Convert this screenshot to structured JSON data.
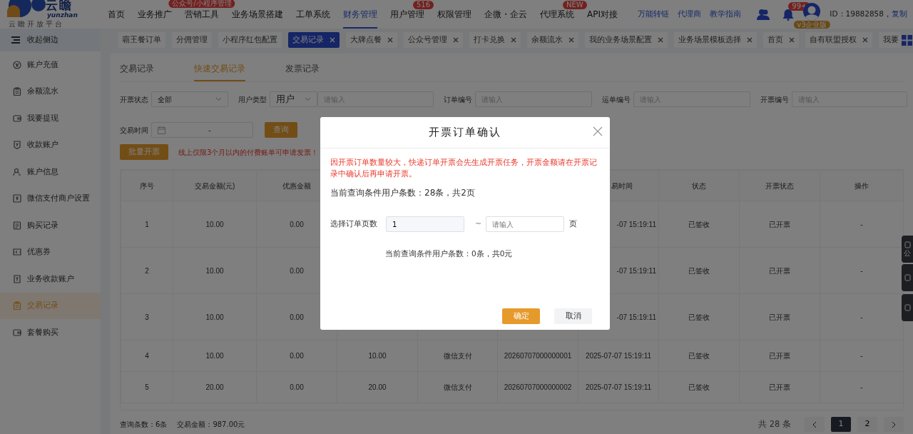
{
  "logo": {
    "title": "云瞻",
    "subtitle": "yunzhan",
    "tagline": "云瞻开放平台"
  },
  "nav": [
    {
      "label": "首页",
      "selected": false
    },
    {
      "label": "业务推广",
      "selected": false
    },
    {
      "label": "营销工具",
      "selected": false,
      "badge": "公众号/小程序管理"
    },
    {
      "label": "业务场景搭建",
      "selected": false
    },
    {
      "label": "工单系统",
      "selected": false
    },
    {
      "label": "财务管理",
      "selected": true
    },
    {
      "label": "用户管理",
      "selected": false,
      "badge": "516"
    },
    {
      "label": "权限管理",
      "selected": false
    },
    {
      "label": "企微・企云",
      "selected": false
    },
    {
      "label": "代理系统",
      "selected": false,
      "badge": "NEW"
    },
    {
      "label": "API对接",
      "selected": false
    }
  ],
  "header_links": [
    "万能转链",
    "代理商",
    "教学指南"
  ],
  "notifications": {
    "badge": "99+"
  },
  "account": {
    "edition": "v3企业版",
    "id": "ID：19882858，",
    "copy": "复制"
  },
  "sidebar": {
    "collapse": "收起侧边",
    "items": [
      {
        "label": "账户充值",
        "selected": false
      },
      {
        "label": "余额流水",
        "selected": false
      },
      {
        "label": "我要提现",
        "selected": false
      },
      {
        "label": "收款账户",
        "selected": false
      },
      {
        "label": "账户信息",
        "selected": false
      },
      {
        "label": "微信支付商户设置",
        "selected": false
      },
      {
        "label": "购买记录",
        "selected": false
      },
      {
        "label": "优惠券",
        "selected": false
      },
      {
        "label": "业务收款账户",
        "selected": false
      },
      {
        "label": "交易记录",
        "selected": true
      },
      {
        "label": "套餐购买",
        "selected": false
      }
    ]
  },
  "open_tabs": [
    {
      "label": "霸王餐订单",
      "selected": false,
      "closable": false
    },
    {
      "label": "分佣管理",
      "selected": false,
      "closable": false
    },
    {
      "label": "小程序红包配置",
      "selected": false,
      "closable": false
    },
    {
      "label": "交易记录",
      "selected": true,
      "closable": true
    },
    {
      "label": "大牌点餐",
      "selected": false,
      "closable": true
    },
    {
      "label": "公众号管理",
      "selected": false,
      "closable": true
    },
    {
      "label": "打卡兑换",
      "selected": false,
      "closable": true
    },
    {
      "label": "余额流水",
      "selected": false,
      "closable": true
    },
    {
      "label": "我的业务场景配置",
      "selected": false,
      "closable": true
    },
    {
      "label": "业务场景模板选择",
      "selected": false,
      "closable": true
    },
    {
      "label": "首页",
      "selected": false,
      "closable": true
    },
    {
      "label": "自有联盟授权",
      "selected": false,
      "closable": true
    },
    {
      "label": "我要",
      "selected": false,
      "closable": false
    }
  ],
  "page_tabs": [
    {
      "label": "交易记录",
      "selected": false
    },
    {
      "label": "快速交易记录",
      "selected": true
    },
    {
      "label": "发票记录",
      "selected": false
    }
  ],
  "filters": {
    "invoice_status": {
      "label": "开票状态",
      "value": "全部"
    },
    "user_type": {
      "label": "用户类型",
      "value": "用户",
      "placeholder": "请输入"
    },
    "order_no": {
      "label": "订单编号",
      "placeholder": "请输入"
    },
    "waybill_no": {
      "label": "运单编号",
      "placeholder": "请输入"
    },
    "invoice_no": {
      "label": "开票编号",
      "placeholder": "请输入"
    },
    "time": {
      "label": "交易时间",
      "separator": "-"
    },
    "search": "查询"
  },
  "batch_button": "批量开票",
  "notice": "线上仅限3个月以内的付费账单可申请发票！",
  "table": {
    "columns": [
      "序号",
      "交易金额(元)",
      "优惠金额",
      null,
      null,
      null,
      "易时间",
      "状态",
      "开票状态",
      "操作"
    ],
    "rows": [
      [
        "1",
        "10.00",
        "0.00",
        null,
        null,
        null,
        "-07 15:19:11",
        "已签收",
        "已开票",
        "-"
      ],
      [
        "2",
        "10.00",
        "0.00",
        null,
        null,
        null,
        "-07 15:19:11",
        "已签收",
        "已开票",
        "-"
      ],
      [
        "3",
        "10.00",
        "0.00",
        null,
        null,
        null,
        "-07 15:19:11",
        "已签收",
        "已开票",
        "-"
      ],
      [
        "4",
        "10.00",
        "0.00",
        "10.00",
        "微信支付",
        "20260707000000001",
        "2025-07-07 15:19:11",
        "已签收",
        "已开票",
        "-"
      ],
      [
        "5",
        "20.00",
        "0.00",
        "20.00",
        "微信支付",
        "20260707000000002",
        "2025-07-07 15:19:11",
        "已签收",
        "已开票",
        "-"
      ]
    ]
  },
  "summary": {
    "count": "查询条数：6条",
    "amount": "交易金额：987.00元"
  },
  "pagination": {
    "total": "共 28 条",
    "pages": [
      {
        "label": "1",
        "selected": true
      },
      {
        "label": "2",
        "selected": false
      }
    ]
  },
  "side_tools": {
    "label": "公"
  },
  "dialog": {
    "title": "开票订单确认",
    "warning": "因开票订单数量较大，快递订单开票会先生成开票任务，开票金额请在开票记录中确认后再申请开票。",
    "query_info": "当前查询条件用户条数：28条，共2页",
    "range_label": "选择订单页数",
    "from_value": "1",
    "separator": "~",
    "to_placeholder": "请输入",
    "unit": "页",
    "result_info": "当前查询条件用户条数：0条，共0元",
    "buttons": [
      {
        "label": "确定",
        "kind": "primary"
      },
      {
        "label": "取消",
        "kind": "secondary"
      }
    ]
  }
}
